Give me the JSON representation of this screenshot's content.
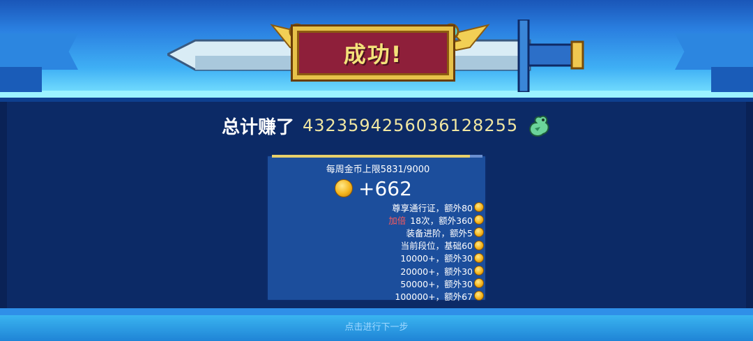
{
  "header": {
    "title": "成功!"
  },
  "summary": {
    "total_label": "总计赚了",
    "total_value": "4323594256036128255",
    "currency_icon": "dragon-icon"
  },
  "reward": {
    "weekly_cap_text": "每周金币上限5831/9000",
    "weekly_cap_fill": 0.648,
    "gain_text": "+662",
    "bonuses": [
      {
        "highlight": "",
        "text": "尊享通行证，额外80"
      },
      {
        "highlight": "加倍",
        "text": "18次，额外360"
      },
      {
        "highlight": "",
        "text": "装备进阶，额外5"
      },
      {
        "highlight": "",
        "text": "当前段位，基础60"
      },
      {
        "highlight": "",
        "text": "10000+，额外30"
      },
      {
        "highlight": "",
        "text": "20000+，额外30"
      },
      {
        "highlight": "",
        "text": "50000+，额外30"
      },
      {
        "highlight": "",
        "text": "100000+，额外67"
      }
    ]
  },
  "footer": {
    "continue_hint": "点击进行下一步"
  },
  "colors": {
    "banner_fill": "#8e1f3a",
    "banner_border": "#e7c24a",
    "title_text": "#f4e27a",
    "total_value": "#f1e7a2",
    "highlight": "#ff5b5b",
    "coin": "#f5b51c"
  }
}
